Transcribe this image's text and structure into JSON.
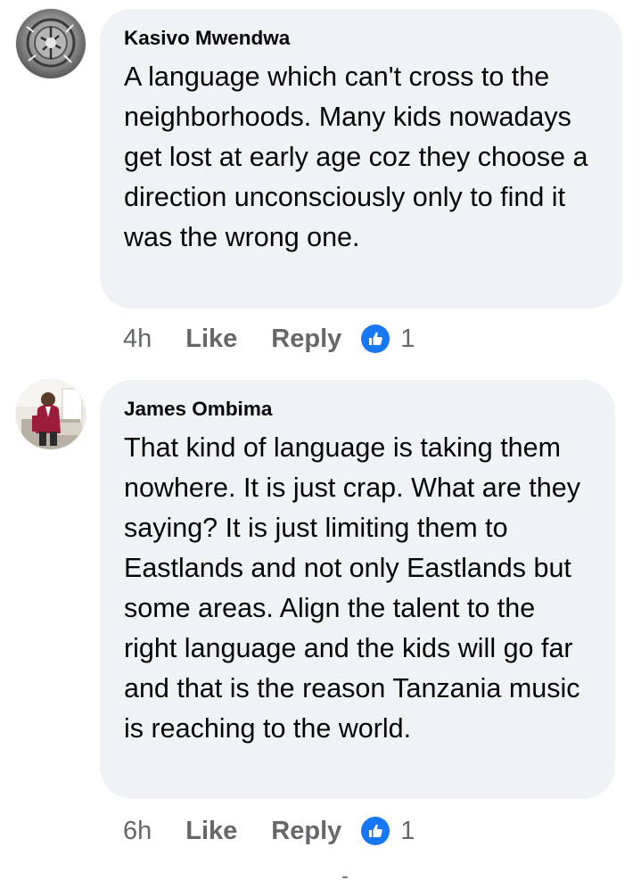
{
  "comments": [
    {
      "author": "Kasivo Mwendwa",
      "avatar_icon": "profile-photo-avatar",
      "text": "A language which can't cross to the neighborhoods. Many kids nowadays get lost at early age coz they choose a direction unconsciously only to find it was the wrong one.",
      "time": "4h",
      "like_label": "Like",
      "reply_label": "Reply",
      "reaction_icon": "thumbs-up-icon",
      "reaction_count": "1"
    },
    {
      "author": "James Ombima",
      "avatar_icon": "profile-photo-avatar",
      "text": "That kind of language is taking them nowhere. It is just crap. What are they saying? It is just limiting them to Eastlands and not only Eastlands but some areas. Align the talent to the right language and the kids will go far and that is the reason Tanzania music is reaching to the world.",
      "time": "6h",
      "like_label": "Like",
      "reply_label": "Reply",
      "reaction_icon": "thumbs-up-icon",
      "reaction_count": "1"
    }
  ],
  "colors": {
    "bubble_bg": "#f0f2f5",
    "secondary_text": "#65676b",
    "reaction_blue": "#1877f2",
    "primary_text": "#050505"
  }
}
